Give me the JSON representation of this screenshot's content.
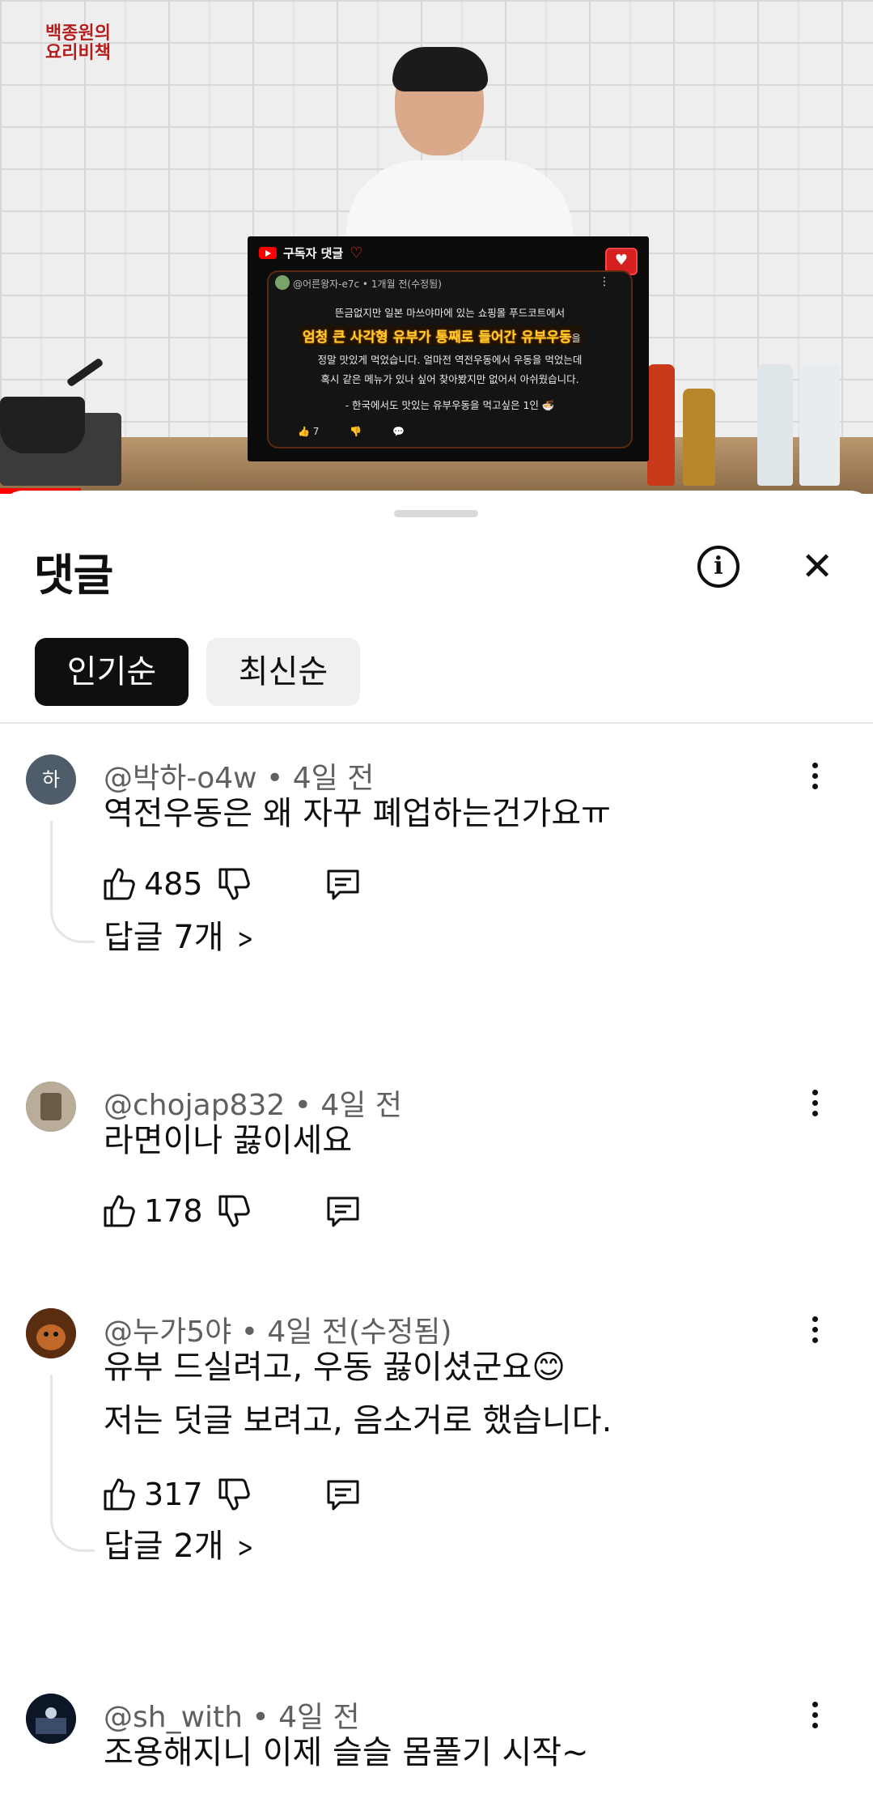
{
  "video": {
    "logo_line1": "백종원의",
    "logo_line2": "요리비책",
    "overlay": {
      "header": "구독자 댓글",
      "username": "@어른왕자-e7c",
      "time": "1개월 전(수정됨)",
      "line1": "뜬금없지만 일본 마쓰야마에 있는 쇼핑몰 푸드코트에서",
      "highlight": "엄청 큰 사각형 유부가 통째로 들어간 유부우동",
      "highlight_suffix": "을",
      "line3": "정말 맛있게 먹었습니다. 얼마전 역전우동에서 우동을 먹었는데",
      "line4": "혹시 같은 메뉴가 있나 싶어 찾아봤지만 없어서 아쉬웠습니다.",
      "line5": "- 한국에서도 맛있는 유부우동을 먹고싶은 1인 🍜",
      "likes": "7"
    }
  },
  "sheet": {
    "title": "댓글",
    "info_icon": "i",
    "close_icon": "✕",
    "sort_chips": [
      {
        "label": "인기순",
        "active": true
      },
      {
        "label": "최신순",
        "active": false
      }
    ]
  },
  "comments": [
    {
      "avatar_text": "하",
      "avatar_color": "#4f5d6b",
      "author": "@박하-o4w",
      "time": "4일 전",
      "lines": [
        "역전우동은 왜 자꾸 폐업하는건가요ㅠ"
      ],
      "likes": "485",
      "replies": "답글 7개"
    },
    {
      "avatar_text": "",
      "avatar_color": "#8a7a66",
      "author": "@chojap832",
      "time": "4일 전",
      "lines": [
        "라면이나 끓이세요"
      ],
      "likes": "178",
      "replies": ""
    },
    {
      "avatar_text": "",
      "avatar_color": "#7a3b12",
      "author": "@누가5야",
      "time": "4일 전(수정됨)",
      "lines": [
        "유부 드실려고, 우동 끓이셨군요😊",
        "저는 덧글 보려고, 음소거로 했습니다."
      ],
      "likes": "317",
      "replies": "답글 2개"
    },
    {
      "avatar_text": "",
      "avatar_color": "#1d2a40",
      "author": "@sh_with",
      "time": "4일 전",
      "lines": [
        "조용해지니 이제 슬슬 몸풀기 시작~"
      ],
      "likes": "",
      "replies": ""
    }
  ]
}
